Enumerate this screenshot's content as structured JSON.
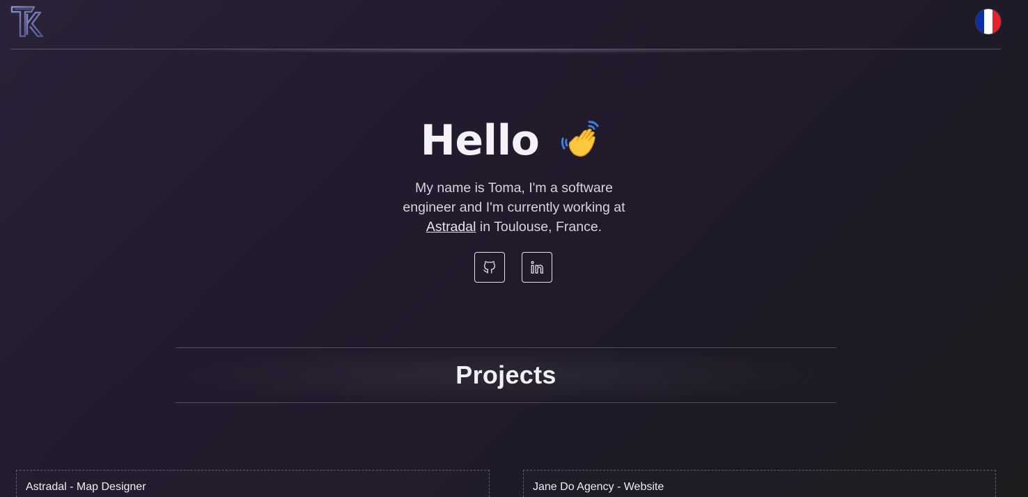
{
  "header": {
    "logo_icon": "tr-monogram-logo",
    "language_flag_icon": "france-flag-icon",
    "flag_colors": [
      "#0b2fa6",
      "#ffffff",
      "#e8222c"
    ]
  },
  "hero": {
    "greeting": "Hello",
    "wave_icon": "waving-hand-icon",
    "intro_before": "My name is Toma, I'm a software engineer and I'm currently working at ",
    "company_link": "Astradal",
    "intro_after": " in Toulouse, France.",
    "socials": [
      {
        "icon": "github-icon"
      },
      {
        "icon": "linkedin-icon"
      }
    ]
  },
  "projects": {
    "title": "Projects",
    "cards": [
      {
        "title": "Astradal - Map Designer"
      },
      {
        "title": "Jane Do Agency - Website"
      }
    ]
  }
}
